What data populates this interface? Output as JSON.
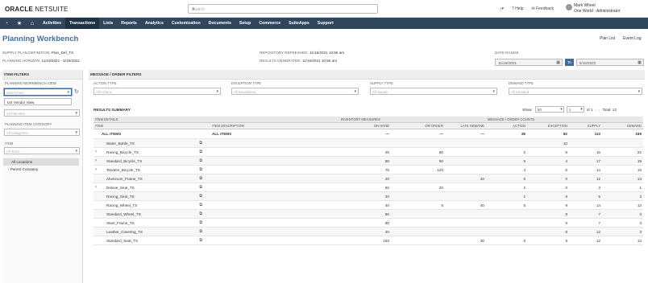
{
  "brand": {
    "oracle": "ORACLE",
    "netsuite": "NETSUITE"
  },
  "search": {
    "placeholder": "Search"
  },
  "top_links": {
    "help": "Help",
    "feedback": "Feedback"
  },
  "user": {
    "name": "Mark Wheel",
    "role": "One World - Administrator"
  },
  "nav": {
    "items": [
      "Activities",
      "Transactions",
      "Lists",
      "Reports",
      "Analytics",
      "Customization",
      "Documents",
      "Setup",
      "Commerce",
      "SuiteApps",
      "Support"
    ],
    "active": "Transactions"
  },
  "page": {
    "title": "Planning Workbench",
    "plan_list": "Plan List",
    "event_log": "Event Log"
  },
  "meta": {
    "supply_plan_label": "SUPPLY PLAN DEFINITION:",
    "supply_plan_value": "Plan_Def_TS",
    "horizon_label": "PLANNING HORIZON:",
    "horizon_value": "11/16/2021 - 5/15/2022",
    "repo_label": "REPOSITORY REFRESHED:",
    "repo_value": "11/16/2021 10:56 am",
    "results_label": "RESULTS GENERATED:",
    "results_value": "11/16/2021 10:56 am",
    "date_range_label": "DATE RANGE",
    "date_from": "11/16/2021",
    "to_label": "To",
    "date_to": "5/15/2022"
  },
  "item_filters": {
    "header": "ITEM FILTERS",
    "workbench_view_label": "PLANNING WORKBENCH VIEW",
    "workbench_view_placeholder": "Select from",
    "dropdown_option": "US Vendor View",
    "planning_item_category_label": "PLANNING ITEM CATEGORY",
    "planning_item_category_placeholder": "All Categories",
    "item_label": "ITEM",
    "item_placeholder": "All Items",
    "second_select_placeholder": "All Planners",
    "locations": [
      "All Locations",
      "Parent Company"
    ]
  },
  "message_filters": {
    "header": "MESSAGE / ORDER FILTERS",
    "action_type_label": "ACTION TYPE",
    "action_type_value": "All Actions",
    "exception_type_label": "EXCEPTION TYPE",
    "exception_type_value": "All Exceptions",
    "supply_type_label": "SUPPLY TYPE",
    "supply_type_value": "All Supply",
    "demand_type_label": "DEMAND TYPE",
    "demand_type_value": "All Demand"
  },
  "results": {
    "title": "RESULTS SUMMARY",
    "show_label": "Show:",
    "show_value": "50",
    "page_value": "1",
    "of_label": "of 1",
    "total_label": "Total: 13",
    "group_headers": {
      "item_details": "ITEM DETAILS",
      "inventory_measures": "INVENTORY MEASURES",
      "message_counts": "MESSAGE / ORDER COUNTS"
    },
    "columns": {
      "item": "ITEM",
      "item_description": "ITEM DESCRIPTION",
      "on_hand": "ON HAND",
      "on_order": "ON ORDER",
      "late_demand": "LATE DEMAND",
      "action": "ACTION",
      "exception": "EXCEPTION",
      "supply": "SUPPLY",
      "demand": "DEMAND"
    },
    "rows": [
      {
        "item": "ALL ITEMS",
        "desc": "ALL ITEMS",
        "on_hand": "—",
        "on_order": "—",
        "late_demand": "—",
        "action": "38",
        "exception": "82",
        "supply": "113",
        "demand": "169",
        "bold": true,
        "expand": false
      },
      {
        "item": "Water_Bottle_TS",
        "desc": "",
        "on_hand": "",
        "on_order": "",
        "late_demand": "",
        "action": "",
        "exception": "10",
        "supply": "",
        "demand": "",
        "bold": false,
        "expand": false
      },
      {
        "item": "Racing_Bicycle_TS",
        "desc": "",
        "on_hand": "25",
        "on_order": "80",
        "late_demand": "",
        "action": "2",
        "exception": "5",
        "supply": "16",
        "demand": "22",
        "bold": false,
        "expand": true
      },
      {
        "item": "Standard_Bicycle_TS",
        "desc": "",
        "on_hand": "80",
        "on_order": "90",
        "late_demand": "",
        "action": "5",
        "exception": "4",
        "supply": "17",
        "demand": "19",
        "bold": false,
        "expand": true
      },
      {
        "item": "Tandem_Bicycle_TS",
        "desc": "",
        "on_hand": "75",
        "on_order": "120",
        "late_demand": "",
        "action": "4",
        "exception": "5",
        "supply": "14",
        "demand": "19",
        "bold": false,
        "expand": true
      },
      {
        "item": "Aluminum_Frame_TS",
        "desc": "",
        "on_hand": "20",
        "on_order": "",
        "late_demand": "40",
        "action": "6",
        "exception": "0",
        "supply": "12",
        "demand": "13",
        "bold": false,
        "expand": false
      },
      {
        "item": "Deluxe_Seat_TS",
        "desc": "",
        "on_hand": "60",
        "on_order": "20",
        "late_demand": "",
        "action": "2",
        "exception": "0",
        "supply": "3",
        "demand": "1",
        "bold": false,
        "expand": true
      },
      {
        "item": "Racing_Seat_TS",
        "desc": "",
        "on_hand": "40",
        "on_order": "",
        "late_demand": "",
        "action": "1",
        "exception": "9",
        "supply": "5",
        "demand": "3",
        "bold": false,
        "expand": false
      },
      {
        "item": "Racing_Wheel_TS",
        "desc": "",
        "on_hand": "40",
        "on_order": "5",
        "late_demand": "40",
        "action": "5",
        "exception": "9",
        "supply": "14",
        "demand": "13",
        "bold": false,
        "expand": false
      },
      {
        "item": "Standard_Wheel_TS",
        "desc": "",
        "on_hand": "80",
        "on_order": "",
        "late_demand": "",
        "action": "",
        "exception": "8",
        "supply": "7",
        "demand": "3",
        "bold": false,
        "expand": false
      },
      {
        "item": "Steel_Frame_TS",
        "desc": "",
        "on_hand": "80",
        "on_order": "",
        "late_demand": "",
        "action": "",
        "exception": "6",
        "supply": "7",
        "demand": "3",
        "bold": false,
        "expand": false
      },
      {
        "item": "Leather_Covering_TS",
        "desc": "",
        "on_hand": "20",
        "on_order": "",
        "late_demand": "",
        "action": "",
        "exception": "8",
        "supply": "12",
        "demand": "3",
        "bold": false,
        "expand": false
      },
      {
        "item": "Standard_Seat_TS",
        "desc": "",
        "on_hand": "160",
        "on_order": "",
        "late_demand": "30",
        "action": "6",
        "exception": "9",
        "supply": "12",
        "demand": "13",
        "bold": false,
        "expand": false
      }
    ]
  }
}
